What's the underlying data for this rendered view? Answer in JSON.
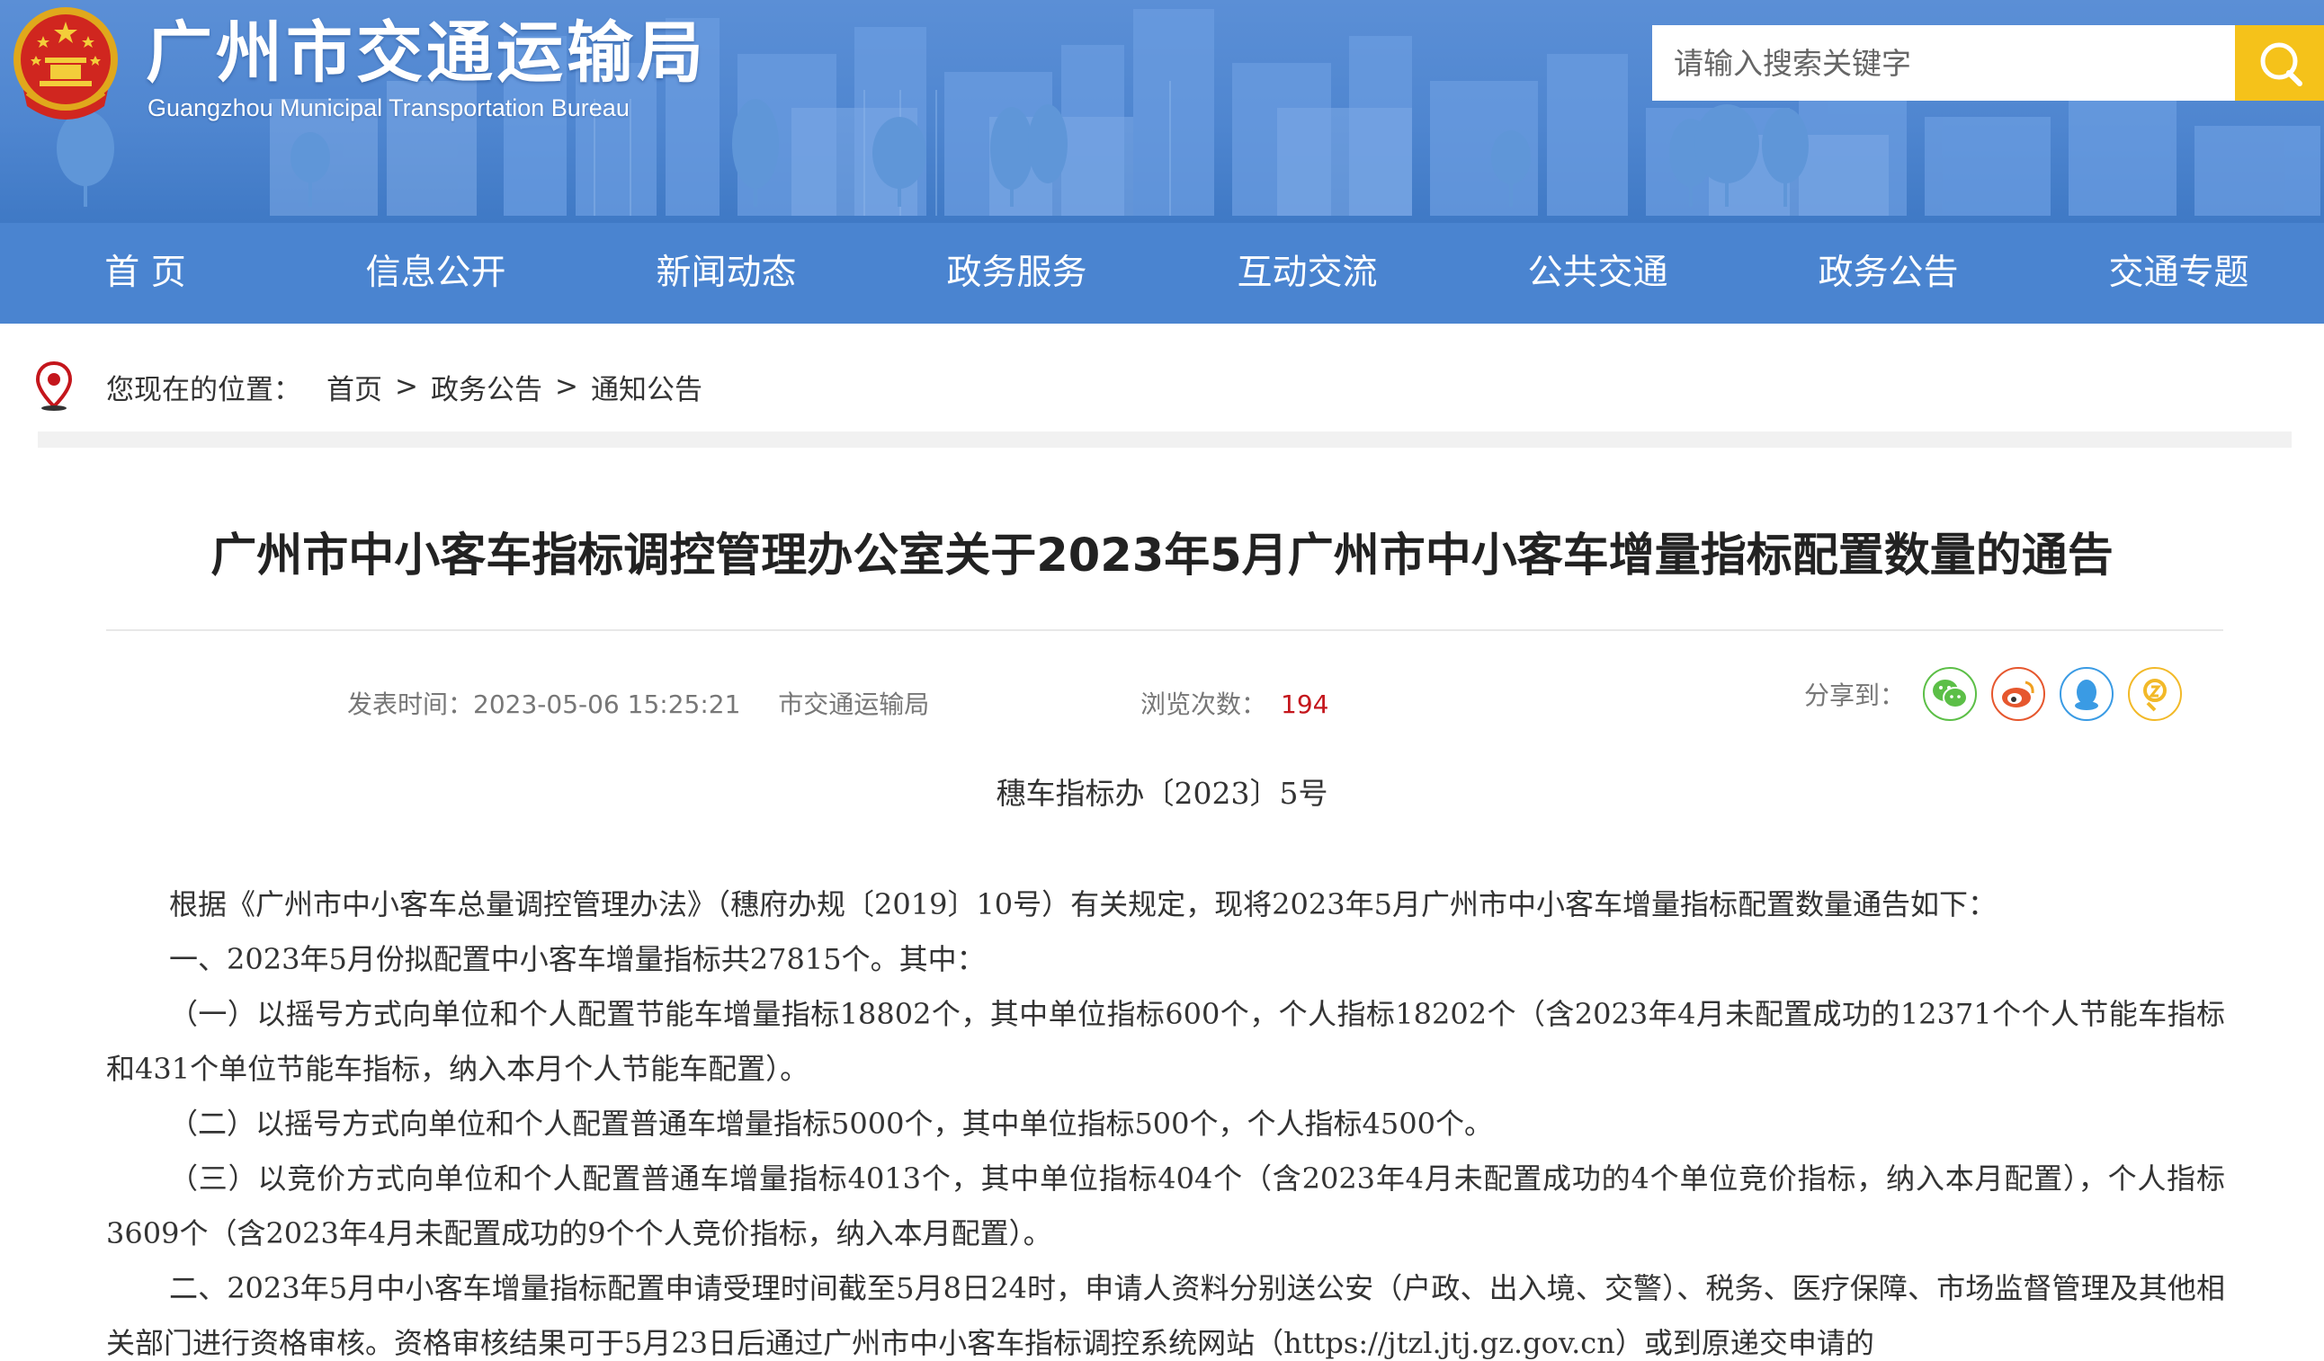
{
  "header": {
    "title": "广州市交通运输局",
    "subtitle": "Guangzhou Municipal Transportation Bureau",
    "search": {
      "placeholder": "请输入搜索关键字"
    }
  },
  "nav": {
    "items": [
      "首 页",
      "信息公开",
      "新闻动态",
      "政务服务",
      "互动交流",
      "公共交通",
      "政务公告",
      "交通专题"
    ]
  },
  "breadcrumb": {
    "label": "您现在的位置：",
    "items": [
      "首页",
      "政务公告",
      "通知公告"
    ],
    "separator": ">"
  },
  "article": {
    "title": "广州市中小客车指标调控管理办公室关于2023年5月广州市中小客车增量指标配置数量的通告",
    "publish_label": "发表时间：",
    "publish_time": "2023-05-06 15:25:21",
    "publisher": "市交通运输局",
    "views_label": "浏览次数：",
    "views": "194",
    "share_label": "分享到：",
    "doc_number": "穗车指标办〔2023〕5号",
    "paragraphs": [
      "根据《广州市中小客车总量调控管理办法》（穗府办规〔2019〕10号）有关规定，现将2023年5月广州市中小客车增量指标配置数量通告如下：",
      "一、2023年5月份拟配置中小客车增量指标共27815个。其中：",
      "（一）以摇号方式向单位和个人配置节能车增量指标18802个，其中单位指标600个，个人指标18202个（含2023年4月未配置成功的12371个个人节能车指标和431个单位节能车指标，纳入本月个人节能车配置）。",
      "（二）以摇号方式向单位和个人配置普通车增量指标5000个，其中单位指标500个，个人指标4500个。",
      "（三）以竞价方式向单位和个人配置普通车增量指标4013个，其中单位指标404个（含2023年4月未配置成功的4个单位竞价指标，纳入本月配置），个人指标3609个（含2023年4月未配置成功的9个个人竞价指标，纳入本月配置）。",
      "二、2023年5月中小客车增量指标配置申请受理时间截至5月8日24时，申请人资料分别送公安（户政、出入境、交警）、税务、医疗保障、市场监督管理及其他相关部门进行资格审核。资格审核结果可于5月23日后通过广州市中小客车指标调控系统网站（https://jtzl.jtj.gz.gov.cn）或到原递交申请的"
    ]
  },
  "share_icons": [
    "wechat-icon",
    "weibo-icon",
    "qq-icon",
    "qzone-icon"
  ],
  "colors": {
    "nav": "#4a84d0",
    "search_button": "#f5c21a",
    "views": "#c4161c"
  }
}
